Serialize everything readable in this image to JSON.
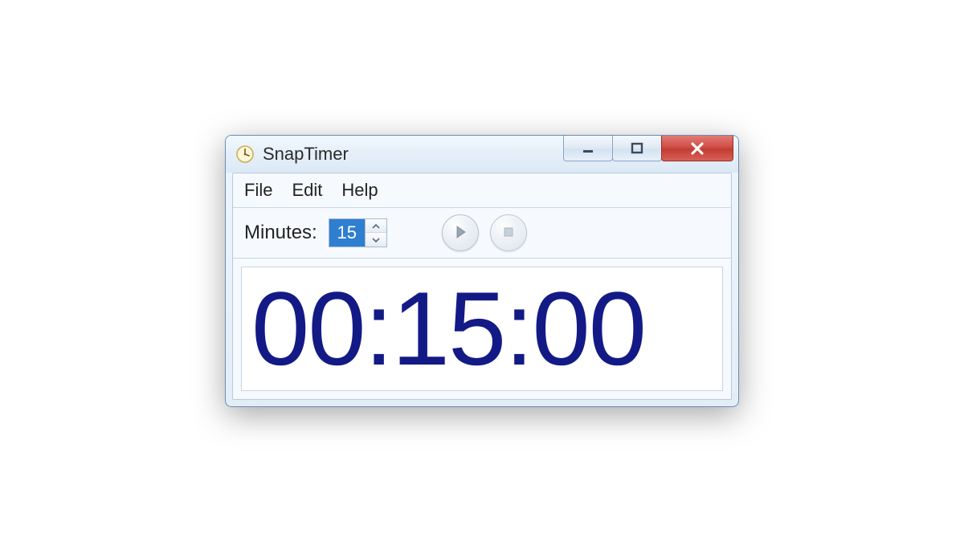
{
  "window": {
    "title": "SnapTimer"
  },
  "menu": {
    "file": "File",
    "edit": "Edit",
    "help": "Help"
  },
  "toolbar": {
    "minutes_label": "Minutes:",
    "minutes_value": "15"
  },
  "timer": {
    "display": "00:15:00"
  },
  "colors": {
    "timer_text": "#131a86",
    "selection_bg": "#2f7fd1",
    "close_btn": "#cf4f47"
  }
}
